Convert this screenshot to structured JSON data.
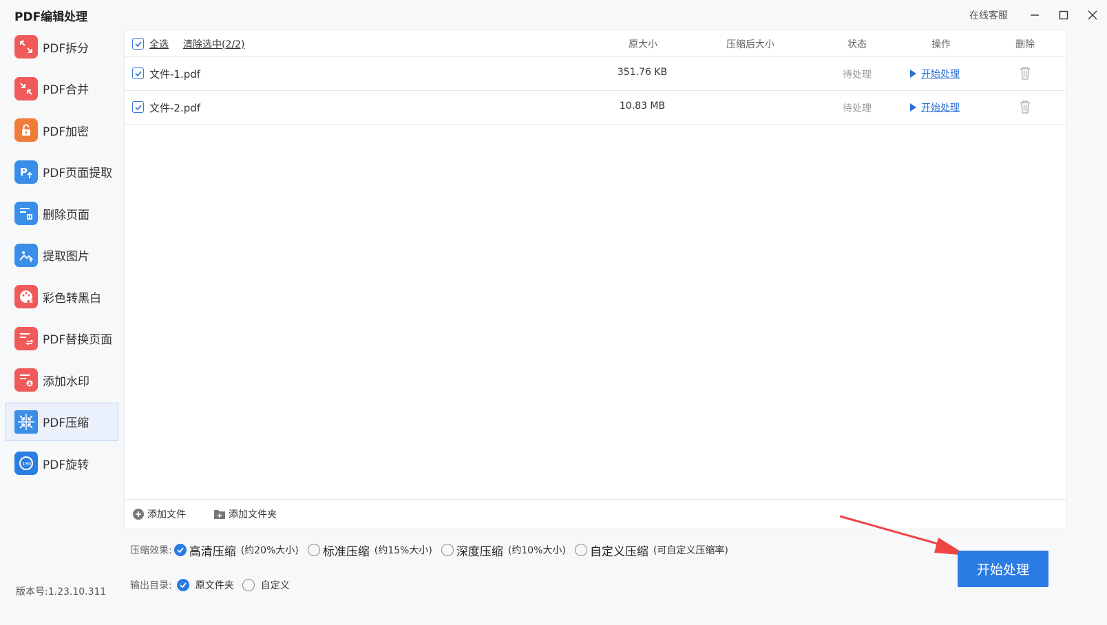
{
  "app": {
    "title": "PDF编辑处理"
  },
  "titlebar": {
    "support_label": "在线客服"
  },
  "sidebar": {
    "items": [
      {
        "label": "PDF拆分",
        "icon": "split-arrows-icon",
        "color": "#ef5b5b",
        "active": false
      },
      {
        "label": "PDF合并",
        "icon": "merge-arrows-icon",
        "color": "#ef5b5b",
        "active": false
      },
      {
        "label": "PDF加密",
        "icon": "lock-icon",
        "color": "#f07c3a",
        "active": false
      },
      {
        "label": "PDF页面提取",
        "icon": "page-extract-icon",
        "color": "#3a8ee8",
        "active": false
      },
      {
        "label": "删除页面",
        "icon": "delete-page-icon",
        "color": "#3a8ee8",
        "active": false
      },
      {
        "label": "提取图片",
        "icon": "extract-image-icon",
        "color": "#3a8ee8",
        "active": false
      },
      {
        "label": "彩色转黑白",
        "icon": "palette-icon",
        "color": "#ef5b5b",
        "active": false
      },
      {
        "label": "PDF替换页面",
        "icon": "replace-page-icon",
        "color": "#ef5b5b",
        "active": false
      },
      {
        "label": "添加水印",
        "icon": "watermark-icon",
        "color": "#ef5b5b",
        "active": false
      },
      {
        "label": "PDF压缩",
        "icon": "compress-arrows-icon",
        "color": "#3a8ee8",
        "active": true
      },
      {
        "label": "PDF旋转",
        "icon": "rotate-180-icon",
        "color": "#3a8ee8",
        "active": false
      }
    ],
    "version": "版本号:1.23.10.311"
  },
  "table": {
    "select_all": "全选",
    "clear_selection": "清除选中(2/2)",
    "columns": {
      "original_size": "原大小",
      "compressed_size": "压缩后大小",
      "status": "状态",
      "action": "操作",
      "delete": "删除"
    },
    "rows": [
      {
        "name": "文件-1.pdf",
        "size": "351.76 KB",
        "compressed": "",
        "status": "待处理",
        "action": "开始处理",
        "checked": true
      },
      {
        "name": "文件-2.pdf",
        "size": "10.83 MB",
        "compressed": "",
        "status": "待处理",
        "action": "开始处理",
        "checked": true
      }
    ]
  },
  "footer": {
    "add_file": "添加文件",
    "add_folder": "添加文件夹"
  },
  "options": {
    "compress_label": "压缩效果:",
    "compress_modes": [
      {
        "label": "高清压缩",
        "note": "(约20%大小)",
        "checked": true
      },
      {
        "label": "标准压缩",
        "note": "(约15%大小)",
        "checked": false
      },
      {
        "label": "深度压缩",
        "note": "(约10%大小)",
        "checked": false
      },
      {
        "label": "自定义压缩",
        "note": "(可自定义压缩率)",
        "checked": false
      }
    ],
    "output_label": "输出目录:",
    "output_modes": [
      {
        "label": "原文件夹",
        "checked": true
      },
      {
        "label": "自定义",
        "checked": false
      }
    ]
  },
  "start_button": {
    "label": "开始处理"
  },
  "colors": {
    "accent": "#2b7be4",
    "annotation_arrow": "#f04545"
  }
}
